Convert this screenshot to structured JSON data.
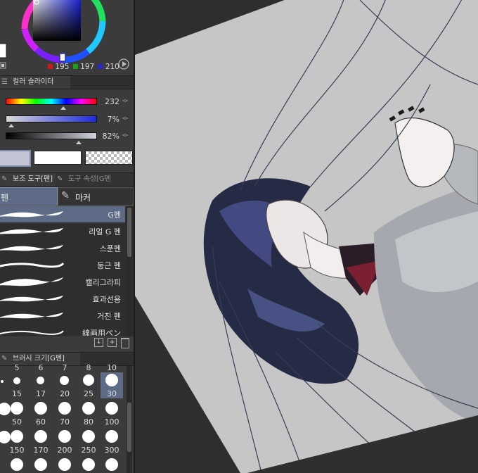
{
  "color_wheel": {
    "r": "195",
    "g": "197",
    "b": "210",
    "r_color": "#d01818",
    "g_color": "#18a018",
    "b_color": "#2828d0"
  },
  "color_slider": {
    "tab_label": "컬러 슬라이더",
    "hue": "232",
    "saturation": "7%",
    "brightness": "82%"
  },
  "tool_tabs": {
    "sub_tool_label": "보조 도구[펜]",
    "tool_property_label": "도구 속성[G펜"
  },
  "pen_groups": {
    "pen": "펜",
    "marker": "마커"
  },
  "brushes": [
    "G펜",
    "리얼 G 펜",
    "스푼펜",
    "둥근 펜",
    "캘리그라피",
    "효과선용",
    "거친 펜",
    "線画用ペン"
  ],
  "brush_size": {
    "tab_label": "브러시 크기[G펜]",
    "top_partial": [
      "5",
      "6",
      "7",
      "8",
      "10"
    ],
    "rows": [
      [
        "",
        "15",
        "17",
        "20",
        "25",
        "30"
      ],
      [
        "",
        "50",
        "60",
        "70",
        "80",
        "100"
      ],
      [
        "",
        "150",
        "170",
        "200",
        "250",
        "300"
      ]
    ],
    "selected": "30"
  },
  "colors": {
    "panel_bg": "#3b3b3b",
    "selection": "#5d6b86",
    "canvas_paper": "#c6c6c6"
  }
}
